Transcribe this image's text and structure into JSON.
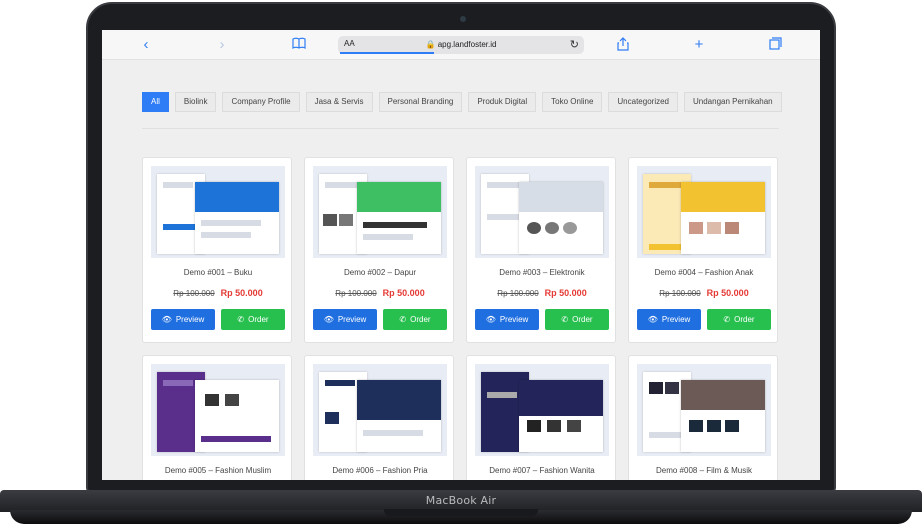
{
  "device": {
    "brand": "MacBook Air"
  },
  "browser": {
    "text_size_label": "AA",
    "url": "apg.landfoster.id",
    "back_icon": "chevron-left-icon",
    "forward_icon": "chevron-right-icon",
    "bookmarks_icon": "book-icon",
    "share_icon": "share-icon",
    "new_tab_icon": "plus-icon",
    "tabs_icon": "tabs-icon",
    "accent": "#2f7df6"
  },
  "filters": [
    {
      "label": "All",
      "active": true
    },
    {
      "label": "Biolink"
    },
    {
      "label": "Company Profile"
    },
    {
      "label": "Jasa & Servis"
    },
    {
      "label": "Personal Branding"
    },
    {
      "label": "Produk Digital"
    },
    {
      "label": "Toko Online"
    },
    {
      "label": "Uncategorized"
    },
    {
      "label": "Undangan Pernikahan"
    }
  ],
  "products": [
    {
      "title": "Demo #001 – Buku",
      "old_price": "Rp 100.000",
      "price": "Rp 50.000",
      "accent": "#1e73d8"
    },
    {
      "title": "Demo #002 – Dapur",
      "old_price": "Rp 100.000",
      "price": "Rp 50.000",
      "accent": "#3fbf63"
    },
    {
      "title": "Demo #003 – Elektronik",
      "old_price": "Rp 100.000",
      "price": "Rp 50.000",
      "accent": "#d7dde7"
    },
    {
      "title": "Demo #004 – Fashion Anak",
      "old_price": "Rp 100.000",
      "price": "Rp 50.000",
      "accent": "#f2c230"
    },
    {
      "title": "Demo #005 – Fashion Muslim",
      "accent": "#5a2f8c"
    },
    {
      "title": "Demo #006 – Fashion Pria",
      "accent": "#1f2f5c"
    },
    {
      "title": "Demo #007 – Fashion Wanita",
      "accent": "#23245a"
    },
    {
      "title": "Demo #008 – Film & Musik",
      "accent": "#6b5a55"
    }
  ],
  "buttons": {
    "preview": "Preview",
    "order": "Order",
    "preview_icon": "eye-icon",
    "order_icon": "whatsapp-icon"
  }
}
